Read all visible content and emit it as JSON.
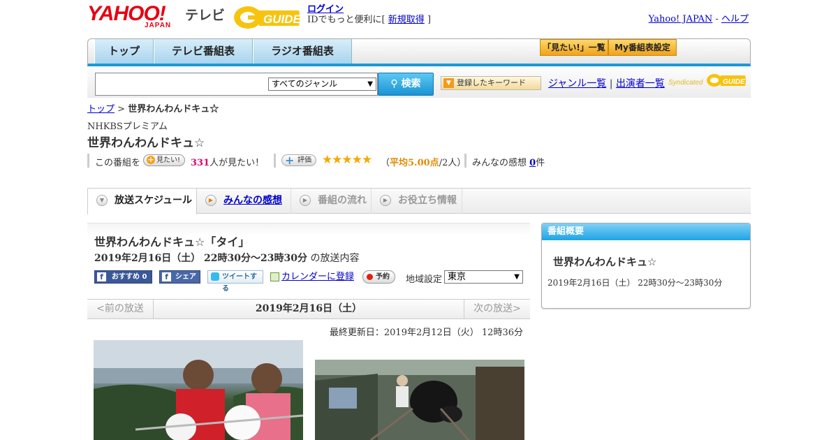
{
  "header": {
    "logo_text": "YAHOO!",
    "logo_sub": "JAPAN",
    "tv_label": "テレビ",
    "guide_logo": "G GUIDE",
    "login_link": "ログイン",
    "login_note_prefix": "IDでもっと便利に[",
    "register_link": "新規取得",
    "login_note_suffix": "]",
    "yahoo_japan_link": "Yahoo! JAPAN",
    "separator": "-",
    "help_link": "ヘルプ"
  },
  "nav": {
    "tabs": [
      "トップ",
      "テレビ番組表",
      "ラジオ番組表"
    ],
    "mitai_list": "「見たい!」一覧",
    "my_schedule": "My番組表設定"
  },
  "search": {
    "input_value": "",
    "genre_selected": "すべてのジャンル",
    "search_button": "検索",
    "keyword_button": "登録したキーワード",
    "genre_list_link": "ジャンル一覧",
    "link_separator": "|",
    "cast_list_link": "出演者一覧",
    "syndicated": "Syndicated"
  },
  "breadcrumb": {
    "top": "トップ",
    "sep": ">",
    "current": "世界わんわんドキュ☆"
  },
  "program": {
    "channel": "NHKBSプレミアム",
    "title": "世界わんわんドキュ☆",
    "want_prefix": "この番組を",
    "want_button": "見たい!",
    "want_count": "331",
    "want_suffix": "人が見たい！",
    "rate_button": "評価",
    "stars": "★★★★★",
    "avg_open": "（",
    "avg_label": "平均5.00点",
    "avg_rest": "/2人）",
    "impressions_label": "みんなの感想",
    "impressions_count": "0",
    "impressions_unit": "件"
  },
  "tabs": {
    "schedule": "放送スケジュール",
    "impressions": "みんなの感想",
    "flow": "番組の流れ",
    "info": "お役立ち情報"
  },
  "episode": {
    "title": "世界わんわんドキュ☆「タイ」",
    "date_time": "2019年2月16日（土） 22時30分～23時30分",
    "date_suffix": "の放送内容",
    "fb_recommend": "おすすめ",
    "fb_count": "0",
    "fb_share": "シェア",
    "tweet": "ツイートする",
    "calendar": "カレンダーに登録",
    "reserve": "予約",
    "region_label": "地域設定",
    "region_value": "東京"
  },
  "pager": {
    "prev": "<前の放送",
    "current": "2019年2月16日（土）",
    "next": "次の放送>"
  },
  "updated": "最終更新日：2019年2月12日（火） 12時36分",
  "sidebar": {
    "heading": "番組概要",
    "title": "世界わんわんドキュ☆",
    "date_time": "2019年2月16日（土） 22時30分～23時30分"
  },
  "colors": {
    "yahoo_red": "#e60012",
    "nav_accent": "#1a9ad8",
    "want_count_pink": "#d6006e",
    "star_gold": "#f5a800",
    "link_blue": "#0000cc"
  }
}
